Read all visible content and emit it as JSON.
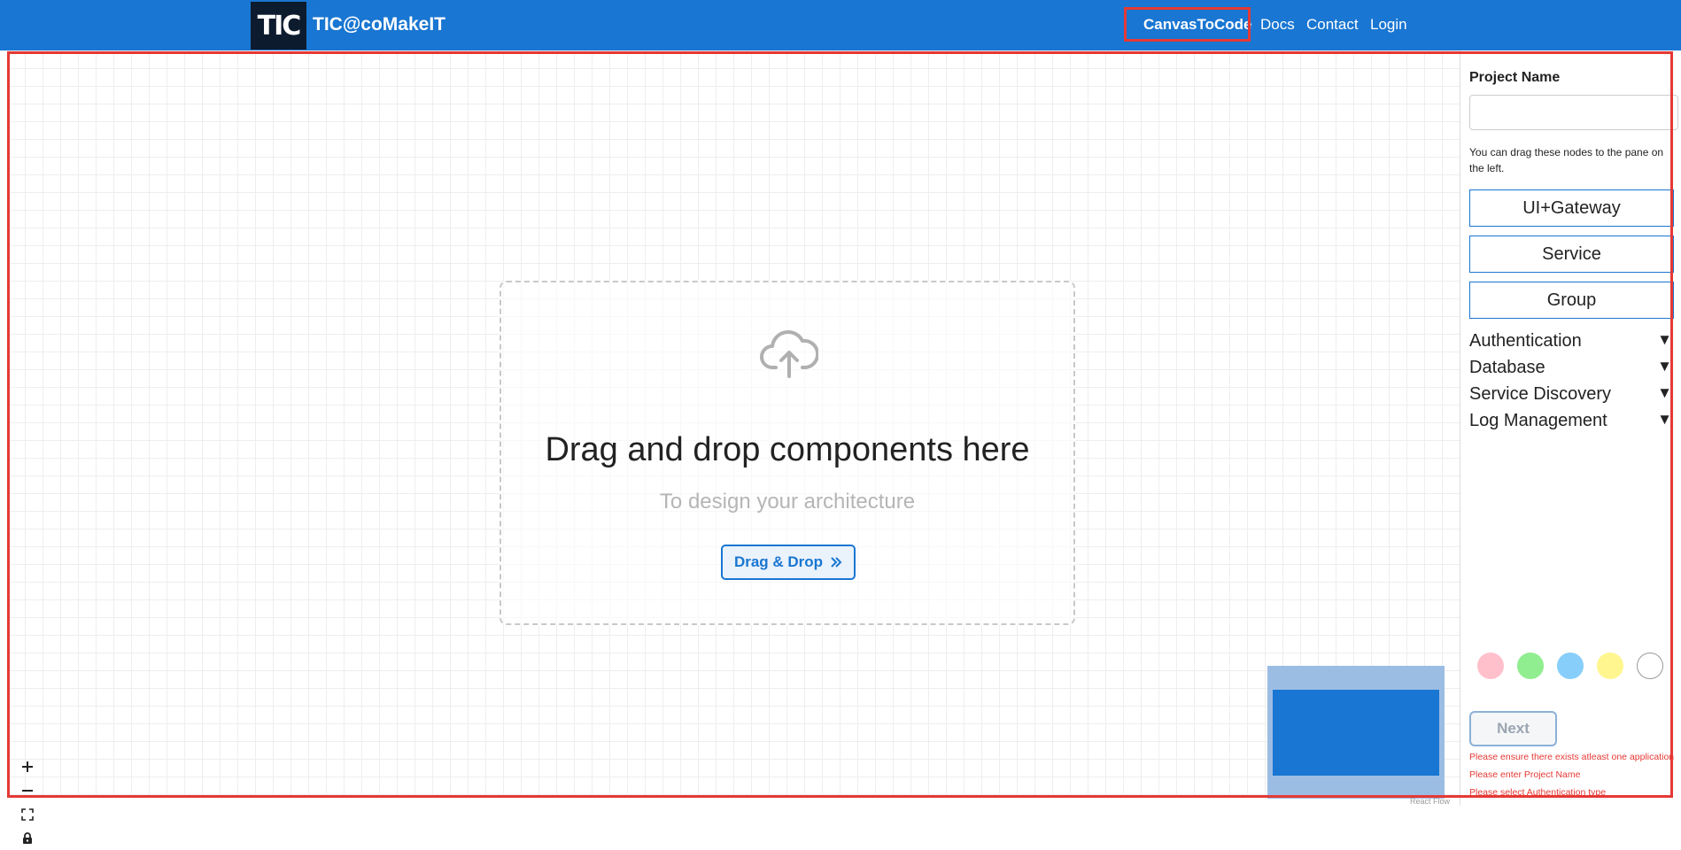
{
  "navbar": {
    "logo_text": "TIC",
    "brand": "TIC@coMakeIT",
    "links": [
      {
        "label": "CanvasToCode",
        "active": true
      },
      {
        "label": "Docs"
      },
      {
        "label": "Contact"
      },
      {
        "label": "Login"
      }
    ],
    "bg_color": "#1976d2"
  },
  "canvas": {
    "dropzone": {
      "icon": "cloud-upload-icon",
      "title": "Drag and drop components here",
      "subtitle": "To design your architecture",
      "button_label": "Drag & Drop",
      "button_icon": "double-chevron-right-icon"
    },
    "controls": [
      {
        "icon": "zoom-in-icon",
        "glyph": "+"
      },
      {
        "icon": "zoom-out-icon",
        "glyph": "−"
      },
      {
        "icon": "fit-view-icon",
        "glyph": "⛶"
      },
      {
        "icon": "lock-icon",
        "glyph": "🔒"
      }
    ],
    "attribution": "React Flow"
  },
  "sidebar": {
    "project_label": "Project Name",
    "project_value": "",
    "help_text": "You can drag these nodes to the pane on the left.",
    "nodes": [
      "UI+Gateway",
      "Service",
      "Group"
    ],
    "accordions": [
      "Authentication",
      "Database",
      "Service Discovery",
      "Log Management"
    ],
    "accordion_arrow": "▼",
    "colors": [
      "#ffc0cb",
      "#90ee90",
      "#87cefa",
      "#fff68f",
      "#ffffff"
    ],
    "next_label": "Next",
    "errors": [
      "Please ensure there exists atleast one application",
      "Please enter Project Name",
      "Please select Authentication type"
    ]
  }
}
